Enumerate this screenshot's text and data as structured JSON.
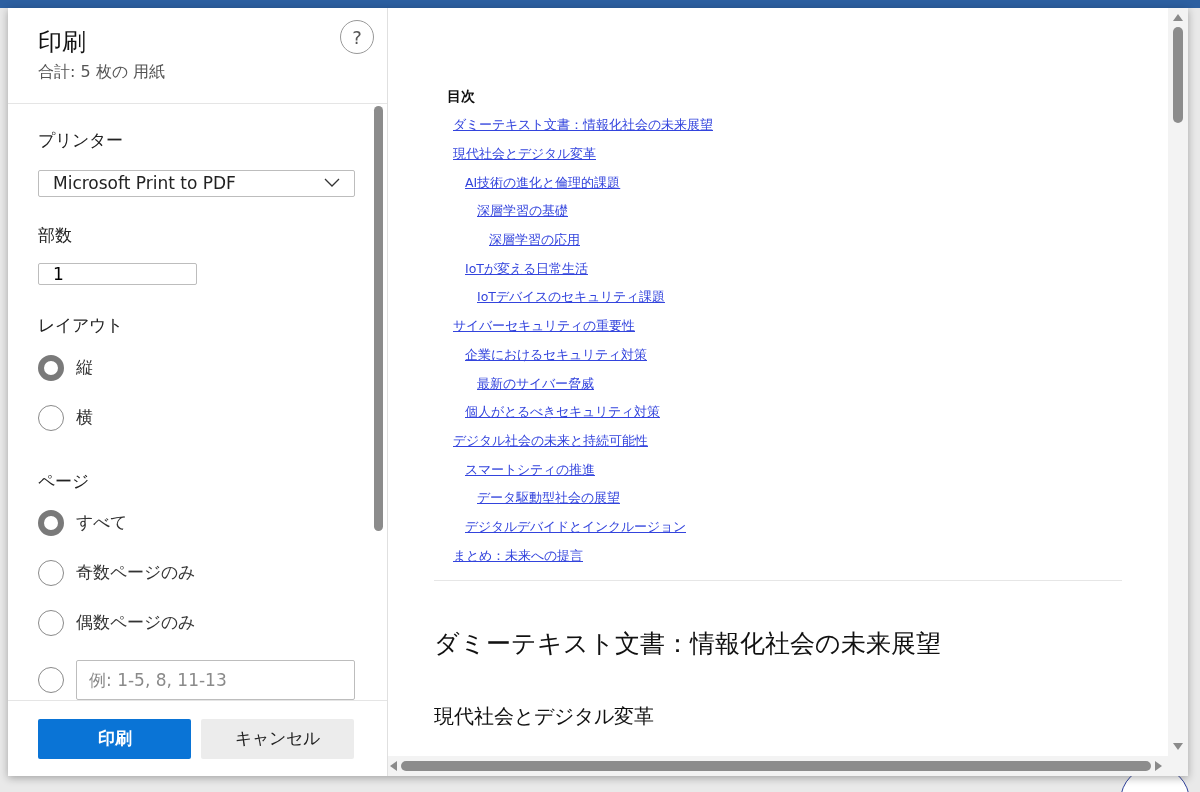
{
  "dialog": {
    "title": "印刷",
    "summary": "合計: 5 枚の 用紙",
    "help": "?"
  },
  "printer": {
    "label": "プリンター",
    "value": "Microsoft Print to PDF"
  },
  "copies": {
    "label": "部数",
    "value": "1"
  },
  "layout": {
    "label": "レイアウト",
    "options": [
      {
        "kind": "option",
        "label": "縦",
        "selected": true
      },
      {
        "kind": "option",
        "label": "横",
        "selected": false
      }
    ]
  },
  "pages": {
    "label": "ページ",
    "options": [
      {
        "kind": "option",
        "label": "すべて",
        "selected": true
      },
      {
        "kind": "option",
        "label": "奇数ページのみ",
        "selected": false
      },
      {
        "kind": "option",
        "label": "偶数ページのみ",
        "selected": false
      },
      {
        "kind": "range",
        "placeholder": "例: 1-5, 8, 11-13",
        "selected": false
      }
    ]
  },
  "buttons": {
    "print": "印刷",
    "cancel": "キャンセル"
  },
  "preview": {
    "toc_title": "目次",
    "toc": [
      {
        "label": "ダミーテキスト文書：情報化社会の未来展望"
      },
      {
        "label": "現代社会とデジタル変革",
        "children": [
          {
            "label": "AI技術の進化と倫理的課題",
            "children": [
              {
                "label": "深層学習の基礎",
                "children": [
                  {
                    "label": "深層学習の応用"
                  }
                ]
              }
            ]
          },
          {
            "label": "IoTが変える日常生活",
            "children": [
              {
                "label": "IoTデバイスのセキュリティ課題"
              }
            ]
          }
        ]
      },
      {
        "label": "サイバーセキュリティの重要性",
        "children": [
          {
            "label": "企業におけるセキュリティ対策",
            "children": [
              {
                "label": "最新のサイバー脅威"
              }
            ]
          },
          {
            "label": "個人がとるべきセキュリティ対策"
          }
        ]
      },
      {
        "label": "デジタル社会の未来と持続可能性",
        "children": [
          {
            "label": "スマートシティの推進",
            "children": [
              {
                "label": "データ駆動型社会の展望"
              }
            ]
          },
          {
            "label": "デジタルデバイドとインクルージョン"
          }
        ]
      },
      {
        "label": "まとめ：未来への提言"
      }
    ],
    "doc_title": "ダミーテキスト文書：情報化社会の未来展望",
    "section_title": "現代社会とデジタル変革"
  }
}
